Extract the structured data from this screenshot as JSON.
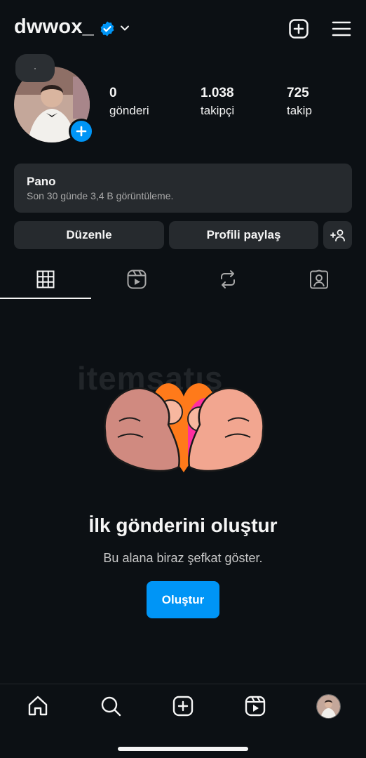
{
  "profile": {
    "username": "dwwox_",
    "note_text": "·"
  },
  "stats": {
    "posts": {
      "value": "0",
      "label": "gönderi"
    },
    "followers": {
      "value": "1.038",
      "label": "takipçi"
    },
    "following": {
      "value": "725",
      "label": "takip"
    }
  },
  "dashboard": {
    "title": "Pano",
    "subtitle": "Son 30 günde 3,4 B görüntüleme."
  },
  "actions": {
    "edit_label": "Düzenle",
    "share_label": "Profili paylaş",
    "add_person_label": "+"
  },
  "tabs": [
    {
      "icon": "grid-icon",
      "active": true
    },
    {
      "icon": "reels-icon",
      "active": false
    },
    {
      "icon": "reposts-icon",
      "active": false
    },
    {
      "icon": "tagged-icon",
      "active": false
    }
  ],
  "empty_state": {
    "watermark": "itemsatış",
    "title": "İlk gönderini oluştur",
    "subtitle": "Bu alana biraz şefkat göster.",
    "button_label": "Oluştur"
  },
  "bottom_nav": [
    "home-icon",
    "search-icon",
    "create-icon",
    "reels-icon",
    "profile-avatar"
  ],
  "colors": {
    "background": "#0c1014",
    "surface": "#262a2e",
    "accent": "#0095f6"
  }
}
